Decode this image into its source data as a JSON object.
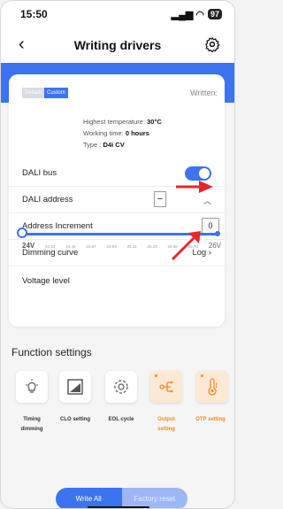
{
  "status": {
    "time": "15:50",
    "battery": "97"
  },
  "nav": {
    "title": "Writing drivers"
  },
  "card": {
    "mode_tabs": [
      "Default",
      "Custom"
    ],
    "written_label": "Written:",
    "info": {
      "highest_temp_label": "Highest temperature:",
      "highest_temp_value": "30°C",
      "working_time_label": "Working time:",
      "working_time_value": "0 hours",
      "type_label": "Type :",
      "type_value": "D4i CV"
    },
    "dali_bus_label": "DALI bus",
    "dali_bus_on": true,
    "dali_address_label": "DALI address",
    "dali_address_minus": "−",
    "address_increment_label": "Address Increment",
    "address_increment_value": "0",
    "dimming_curve_label": "Dimming curve",
    "dimming_curve_value": "Log",
    "voltage_label": "Voltage level",
    "voltage_ticks": [
      "24V",
      "24.22",
      "24.44",
      "24.67",
      "24.89",
      "25.11",
      "25.33",
      "25.56",
      "25.78",
      "26V"
    ],
    "voltage_level_fraction": 0.0
  },
  "function_settings": {
    "title": "Function settings",
    "items": [
      {
        "label_line1": "Timing",
        "label_line2": "dimming",
        "icon": "bulb-icon",
        "highlight": false
      },
      {
        "label_line1": "CLO setting",
        "label_line2": "",
        "icon": "chart-icon",
        "highlight": false
      },
      {
        "label_line1": "EOL cycle",
        "label_line2": "",
        "icon": "cycle-icon",
        "highlight": false
      },
      {
        "label_line1": "Output",
        "label_line2": "setting",
        "icon": "output-icon",
        "highlight": true
      },
      {
        "label_line1": "OTP setting",
        "label_line2": "",
        "icon": "thermometer-icon",
        "highlight": true
      }
    ]
  },
  "actions": {
    "write_all": "Write All",
    "factory_reset": "Factory reset"
  },
  "colors": {
    "accent": "#3d73f0",
    "orange": "#f08a28",
    "annotation": "#e8262c"
  }
}
